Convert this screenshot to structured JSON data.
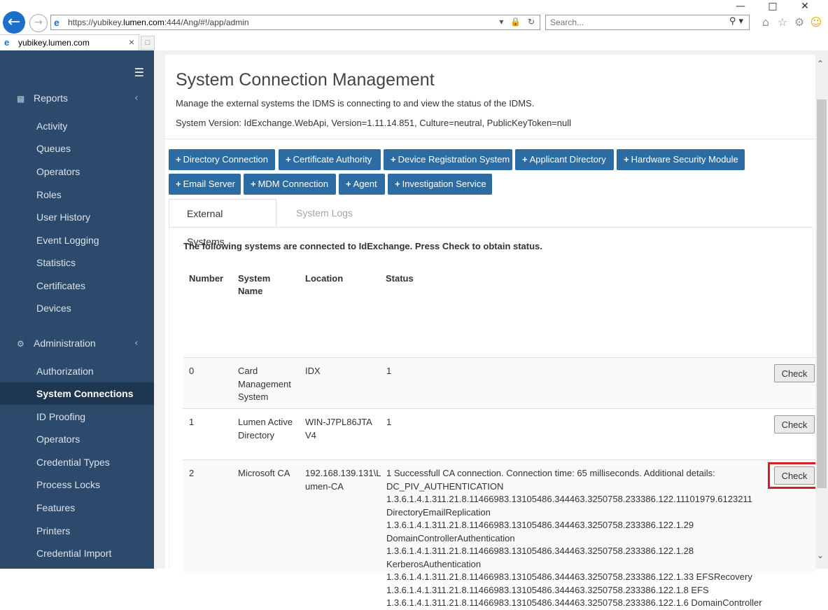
{
  "browser": {
    "url_prefix": "https://yubikey.",
    "url_domain": "lumen.com",
    "url_suffix": ":444/Ang/#!/app/admin",
    "search_placeholder": "Search...",
    "tab_title": "yubikey.lumen.com"
  },
  "sidebar": {
    "reports_label": "Reports",
    "reports_items": [
      "Activity",
      "Queues",
      "Operators",
      "Roles",
      "User History",
      "Event Logging",
      "Statistics",
      "Certificates",
      "Devices"
    ],
    "admin_label": "Administration",
    "admin_items": [
      "Authorization",
      "System Connections",
      "ID Proofing",
      "Operators",
      "Credential Types",
      "Process Locks",
      "Features",
      "Printers",
      "Credential Import"
    ],
    "active_item": "System Connections"
  },
  "page": {
    "title": "System Connection Management",
    "description": "Manage the external systems the IDMS is connecting to and view the status of the IDMS.",
    "version": "System Version: IdExchange.WebApi, Version=1.11.14.851, Culture=neutral, PublicKeyToken=null"
  },
  "add_buttons": [
    "Directory Connection",
    "Certificate Authority",
    "Device Registration System",
    "Applicant Directory",
    "Hardware Security Module",
    "Email Server",
    "MDM Connection",
    "Agent",
    "Investigation Service"
  ],
  "tabs": [
    "External Systems",
    "System Logs"
  ],
  "table": {
    "intro": "The following systems are connected to IdExchange. Press Check to obtain status.",
    "headers": [
      "Number",
      "System Name",
      "Location",
      "Status"
    ],
    "check_label": "Check",
    "rows": [
      {
        "number": "0",
        "name": "Card Management System",
        "location": "IDX",
        "status": "1"
      },
      {
        "number": "1",
        "name": "Lumen Active Directory",
        "location": "WIN-J7PL86JTAV4",
        "status": "1"
      },
      {
        "number": "2",
        "name": "Microsoft CA",
        "location": "192.168.139.131\\Lumen-CA",
        "status": "1 Successfull CA connection. Connection time: 65 milliseconds. Additional details: DC_PIV_AUTHENTICATION 1.3.6.1.4.1.311.21.8.11466983.13105486.344463.3250758.233386.122.11101979.6123211 DirectoryEmailReplication 1.3.6.1.4.1.311.21.8.11466983.13105486.344463.3250758.233386.122.1.29 DomainControllerAuthentication 1.3.6.1.4.1.311.21.8.11466983.13105486.344463.3250758.233386.122.1.28 KerberosAuthentication 1.3.6.1.4.1.311.21.8.11466983.13105486.344463.3250758.233386.122.1.33 EFSRecovery 1.3.6.1.4.1.311.21.8.11466983.13105486.344463.3250758.233386.122.1.8 EFS 1.3.6.1.4.1.311.21.8.11466983.13105486.344463.3250758.233386.122.1.6 DomainController"
      }
    ]
  },
  "colors": {
    "sidebar_bg": "#2c4a6b",
    "button_blue": "#2d6ca2",
    "highlight_red": "#d0202a"
  }
}
